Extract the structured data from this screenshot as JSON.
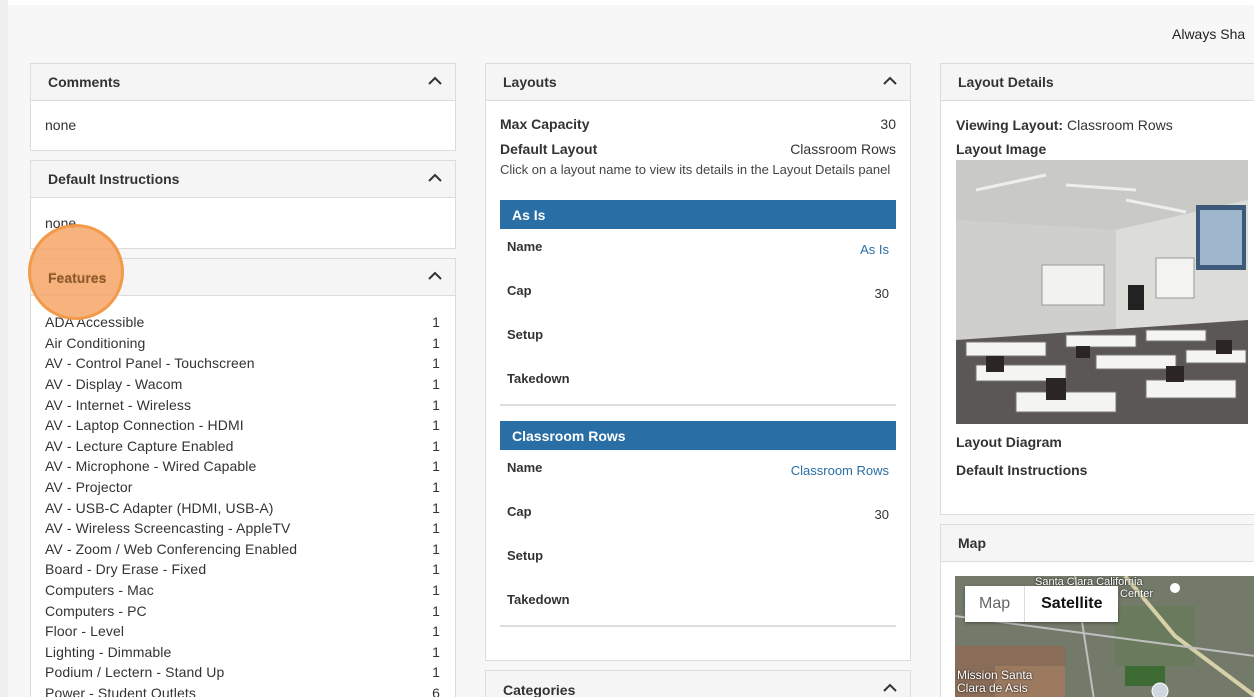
{
  "header": {
    "share_text": "Always Sha"
  },
  "comments": {
    "title": "Comments",
    "value": "none"
  },
  "default_instructions": {
    "title": "Default Instructions",
    "value": "none"
  },
  "features": {
    "title": "Features",
    "items": [
      {
        "label": "ADA Accessible",
        "count": "1"
      },
      {
        "label": "Air Conditioning",
        "count": "1"
      },
      {
        "label": "AV - Control Panel - Touchscreen",
        "count": "1"
      },
      {
        "label": "AV - Display - Wacom",
        "count": "1"
      },
      {
        "label": "AV - Internet - Wireless",
        "count": "1"
      },
      {
        "label": "AV - Laptop Connection - HDMI",
        "count": "1"
      },
      {
        "label": "AV - Lecture Capture Enabled",
        "count": "1"
      },
      {
        "label": "AV - Microphone - Wired Capable",
        "count": "1"
      },
      {
        "label": "AV - Projector",
        "count": "1"
      },
      {
        "label": "AV - USB-C Adapter (HDMI, USB-A)",
        "count": "1"
      },
      {
        "label": "AV - Wireless Screencasting - AppleTV",
        "count": "1"
      },
      {
        "label": "AV - Zoom / Web Conferencing Enabled",
        "count": "1"
      },
      {
        "label": "Board - Dry Erase - Fixed",
        "count": "1"
      },
      {
        "label": "Computers - Mac",
        "count": "1"
      },
      {
        "label": "Computers - PC",
        "count": "1"
      },
      {
        "label": "Floor - Level",
        "count": "1"
      },
      {
        "label": "Lighting - Dimmable",
        "count": "1"
      },
      {
        "label": "Podium / Lectern - Stand Up",
        "count": "1"
      },
      {
        "label": "Power - Student Outlets",
        "count": "6"
      }
    ]
  },
  "layouts": {
    "title": "Layouts",
    "max_capacity_label": "Max Capacity",
    "max_capacity_value": "30",
    "default_layout_label": "Default Layout",
    "default_layout_value": "Classroom Rows",
    "hint": "Click on a layout name to view its details in the Layout Details panel",
    "items": [
      {
        "header": "As Is",
        "name_label": "Name",
        "name": "As Is",
        "cap_label": "Cap",
        "cap": "30",
        "setup_label": "Setup",
        "takedown_label": "Takedown"
      },
      {
        "header": "Classroom Rows",
        "name_label": "Name",
        "name": "Classroom Rows",
        "cap_label": "Cap",
        "cap": "30",
        "setup_label": "Setup",
        "takedown_label": "Takedown"
      }
    ]
  },
  "categories": {
    "title": "Categories"
  },
  "layout_details": {
    "title": "Layout Details",
    "viewing_label": "Viewing Layout:",
    "viewing_value": "Classroom Rows",
    "image_label": "Layout Image",
    "diagram_label": "Layout Diagram",
    "instructions_label": "Default Instructions"
  },
  "map": {
    "title": "Map",
    "map_tab": "Map",
    "satellite_tab": "Satellite",
    "place_label": "Santa Clara California",
    "center_label": "Center",
    "mission_label": "Mission Santa",
    "mission_label2": "Clara de Asis"
  }
}
